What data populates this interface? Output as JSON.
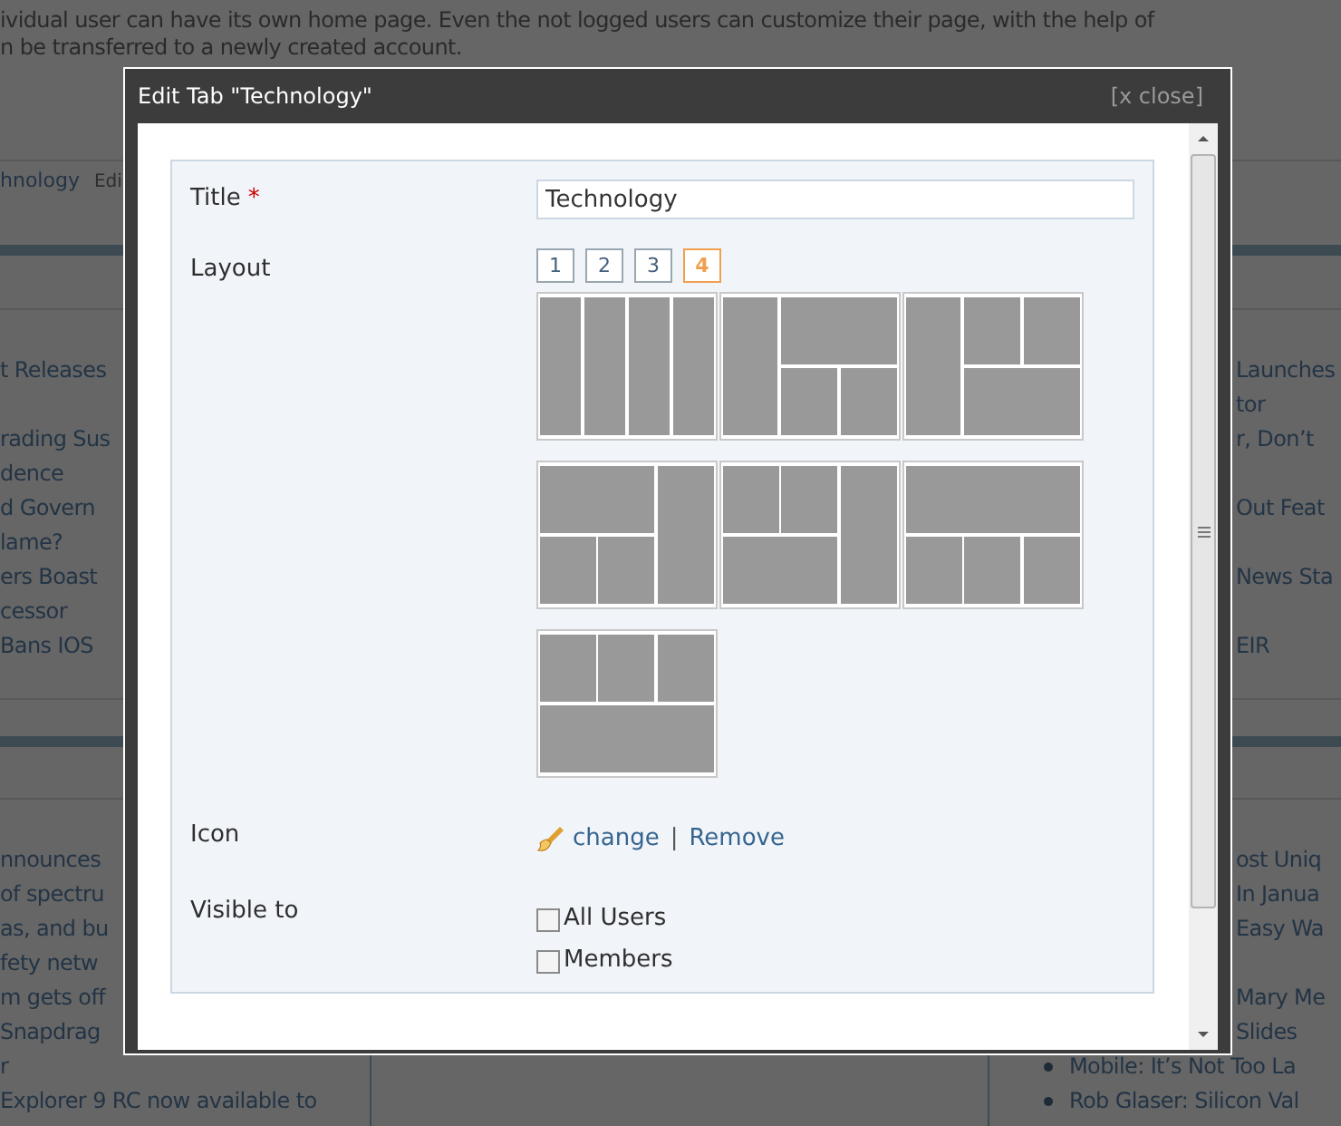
{
  "page": {
    "intro_lines": [
      "ividual user can have its own home page. Even the not logged users can customize their page, with the help of",
      "n be transferred to a newly created account."
    ],
    "tab_bar": {
      "label": "hnology",
      "edit": "Edi"
    },
    "sections": [
      {
        "left": [
          [
            "t Releases"
          ],
          [
            "rading Sus",
            "dence"
          ],
          [
            "d Govern",
            "lame?"
          ],
          [
            "ers Boast",
            "cessor"
          ],
          [
            "Bans IOS"
          ]
        ],
        "right": [
          [
            "Launches",
            "tor"
          ],
          [
            "r, Don’t"
          ],
          [
            "Out Feat"
          ],
          [
            "News Sta"
          ],
          [
            "EIR"
          ]
        ]
      },
      {
        "left": [
          [
            "nnounces",
            "of spectru",
            "as, and bu",
            "fety netw"
          ],
          [
            "m gets off",
            "Snapdrag",
            "r"
          ],
          [
            "Explorer 9 RC now available to"
          ]
        ],
        "right": [
          [
            "ost Uniq",
            "In Janua"
          ],
          [
            "Easy Wa"
          ],
          [
            "Mary Me",
            "Slides"
          ]
        ],
        "bullets": [
          "Mobile: It’s Not Too La",
          "Rob Glaser: Silicon Val"
        ]
      }
    ]
  },
  "dialog": {
    "title": "Edit Tab \"Technology\"",
    "close": "[x close]",
    "title_field": {
      "label": "Title",
      "required_mark": "*",
      "value": "Technology"
    },
    "layout": {
      "label": "Layout",
      "counts": [
        {
          "label": "1",
          "selected": false
        },
        {
          "label": "2",
          "selected": false
        },
        {
          "label": "3",
          "selected": false
        },
        {
          "label": "4",
          "selected": true
        }
      ],
      "options": [
        {
          "kind": "four-columns"
        },
        {
          "kind": "left-column-top-wide"
        },
        {
          "kind": "left-column-top-two"
        },
        {
          "kind": "right-column-top-wide"
        },
        {
          "kind": "right-column-bottom-wide"
        },
        {
          "kind": "top-wide-bottom-three"
        },
        {
          "kind": "top-three-bottom-wide"
        }
      ]
    },
    "icon": {
      "label": "Icon",
      "change": "change",
      "separator": "|",
      "remove": "Remove"
    },
    "visibility": {
      "label": "Visible to",
      "options": [
        {
          "label": "All Users",
          "checked": false
        },
        {
          "label": "Members",
          "checked": false
        }
      ]
    }
  }
}
